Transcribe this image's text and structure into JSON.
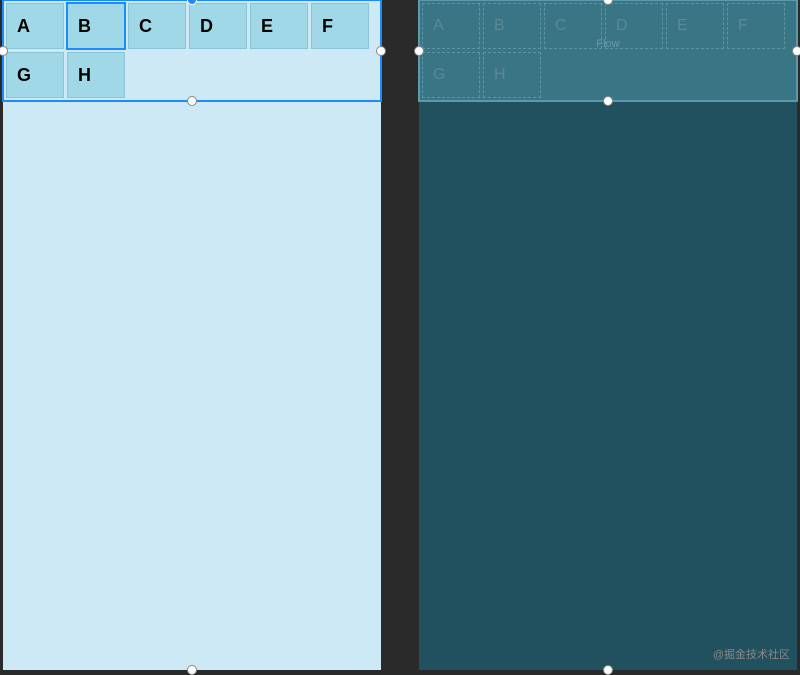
{
  "leftPanel": {
    "cells": [
      "A",
      "B",
      "C",
      "D",
      "E",
      "F",
      "G",
      "H"
    ]
  },
  "rightPanel": {
    "cells": [
      "A",
      "B",
      "C",
      "D",
      "E",
      "F",
      "G",
      "H"
    ],
    "flowLabel": "Flow"
  },
  "watermark": "@掘金技术社区"
}
